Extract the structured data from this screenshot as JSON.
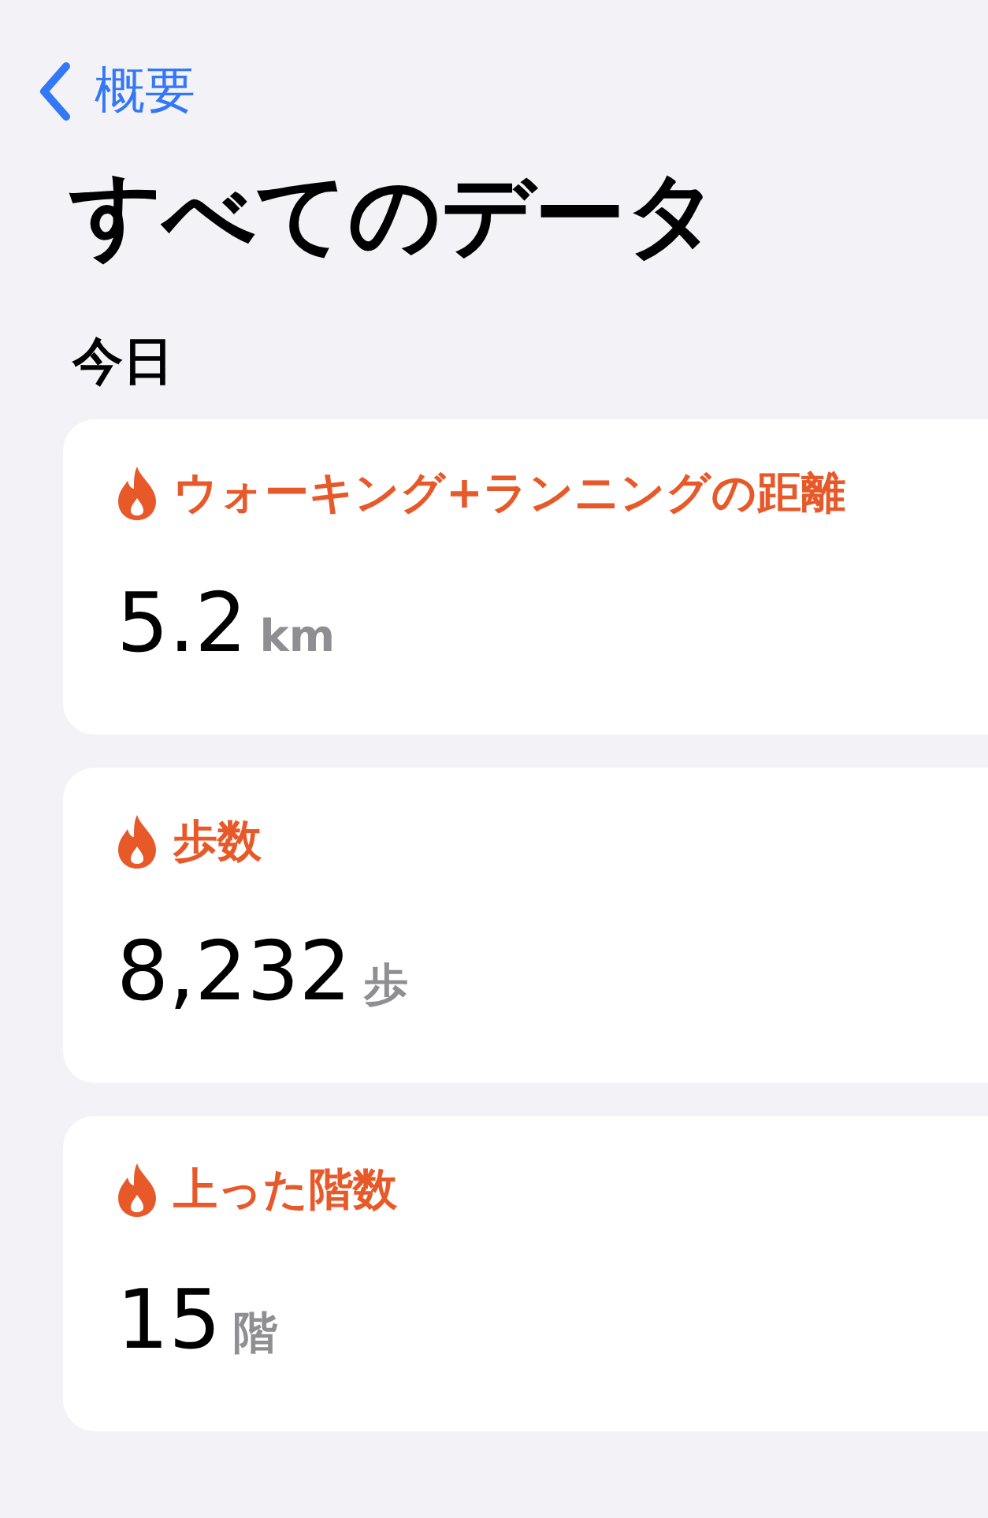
{
  "nav": {
    "back_label": "概要"
  },
  "title": "すべてのデータ",
  "section": {
    "heading": "今日",
    "cards": [
      {
        "label": "ウォーキング+ランニングの距離",
        "value": "5.2",
        "unit": "km"
      },
      {
        "label": "歩数",
        "value": "8,232",
        "unit": "歩"
      },
      {
        "label": "上った階数",
        "value": "15",
        "unit": "階"
      }
    ]
  }
}
